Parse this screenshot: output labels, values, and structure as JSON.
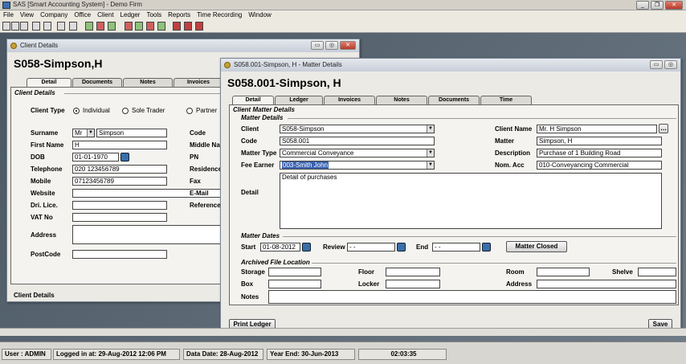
{
  "app": {
    "title": "SAS [Smart Accounting System] - Demo Firm"
  },
  "menu": [
    "File",
    "View",
    "Company",
    "Office",
    "Client",
    "Ledger",
    "Tools",
    "Reports",
    "Time Recording",
    "Window"
  ],
  "client_window": {
    "title": "Client Details",
    "heading": "S058-Simpson,H",
    "tabs": [
      "Detail",
      "Documents",
      "Notes",
      "Invoices"
    ],
    "section": "Client Details",
    "client_type_label": "Client Type",
    "client_type_options": [
      "Individual",
      "Sole Trader",
      "Partner"
    ],
    "labels": {
      "surname": "Surname",
      "first_name": "First Name",
      "dob": "DOB",
      "telephone": "Telephone",
      "mobile": "Mobile",
      "website": "Website",
      "dri_lice": "Dri. Lice.",
      "vat_no": "VAT No",
      "address": "Address",
      "postcode": "PostCode",
      "code": "Code",
      "middle_name": "Middle Na",
      "pn": "PN",
      "residence": "Residence",
      "fax": "Fax",
      "email": "E-Mail",
      "reference": "Reference"
    },
    "values": {
      "title": "Mr",
      "surname": "Simpson",
      "first_name": "H",
      "dob": "01-01-1970",
      "telephone": "020 123456789",
      "mobile": "07123456789",
      "website": "",
      "dri_lice": "",
      "vat_no": "",
      "address": "",
      "postcode": ""
    },
    "footer": "Client Details"
  },
  "matter_window": {
    "title": "S058.001-Simpson, H - Matter Details",
    "heading": "S058.001-Simpson, H",
    "tabs": [
      "Detail",
      "Ledger",
      "Invoices",
      "Notes",
      "Documents",
      "Time"
    ],
    "section": "Client Matter Details",
    "matter_details_group": "Matter Details",
    "labels": {
      "client": "Client",
      "code": "Code",
      "matter_type": "Matter Type",
      "fee_earner": "Fee Earner",
      "detail": "Detail",
      "client_name": "Client Name",
      "matter": "Matter",
      "description": "Description",
      "nom_acc": "Nom. Acc"
    },
    "values": {
      "client": "S058-Simpson",
      "code": "S058.001",
      "matter_type": "Commercial Conveyance",
      "fee_earner": "003-Smith John",
      "detail": "Detail of purchases",
      "client_name": "Mr. H Simpson",
      "matter": "Simpson, H",
      "description": "Purchase of 1 Building Road",
      "nom_acc": "010-Conveyancing Commercial"
    },
    "dates_group": "Matter Dates",
    "dates": {
      "start_label": "Start",
      "start": "01-08-2012",
      "review_label": "Review",
      "review": "  -  -",
      "end_label": "End",
      "end": "  -  -",
      "closed_button": "Matter Closed"
    },
    "archive_group": "Archived File Location",
    "archive_labels": {
      "storage": "Storage",
      "box": "Box",
      "floor": "Floor",
      "locker": "Locker",
      "room": "Room",
      "address": "Address",
      "shelve": "Shelve",
      "notes": "Notes"
    },
    "buttons": {
      "print_ledger": "Print Ledger",
      "save": "Save"
    }
  },
  "status": {
    "user": "User : ADMIN",
    "logged_in": "Logged in at: 29-Aug-2012 12:06 PM",
    "data_date": "Data Date: 28-Aug-2012",
    "year_end": "Year End: 30-Jun-2013",
    "clock": "02:03:35"
  }
}
